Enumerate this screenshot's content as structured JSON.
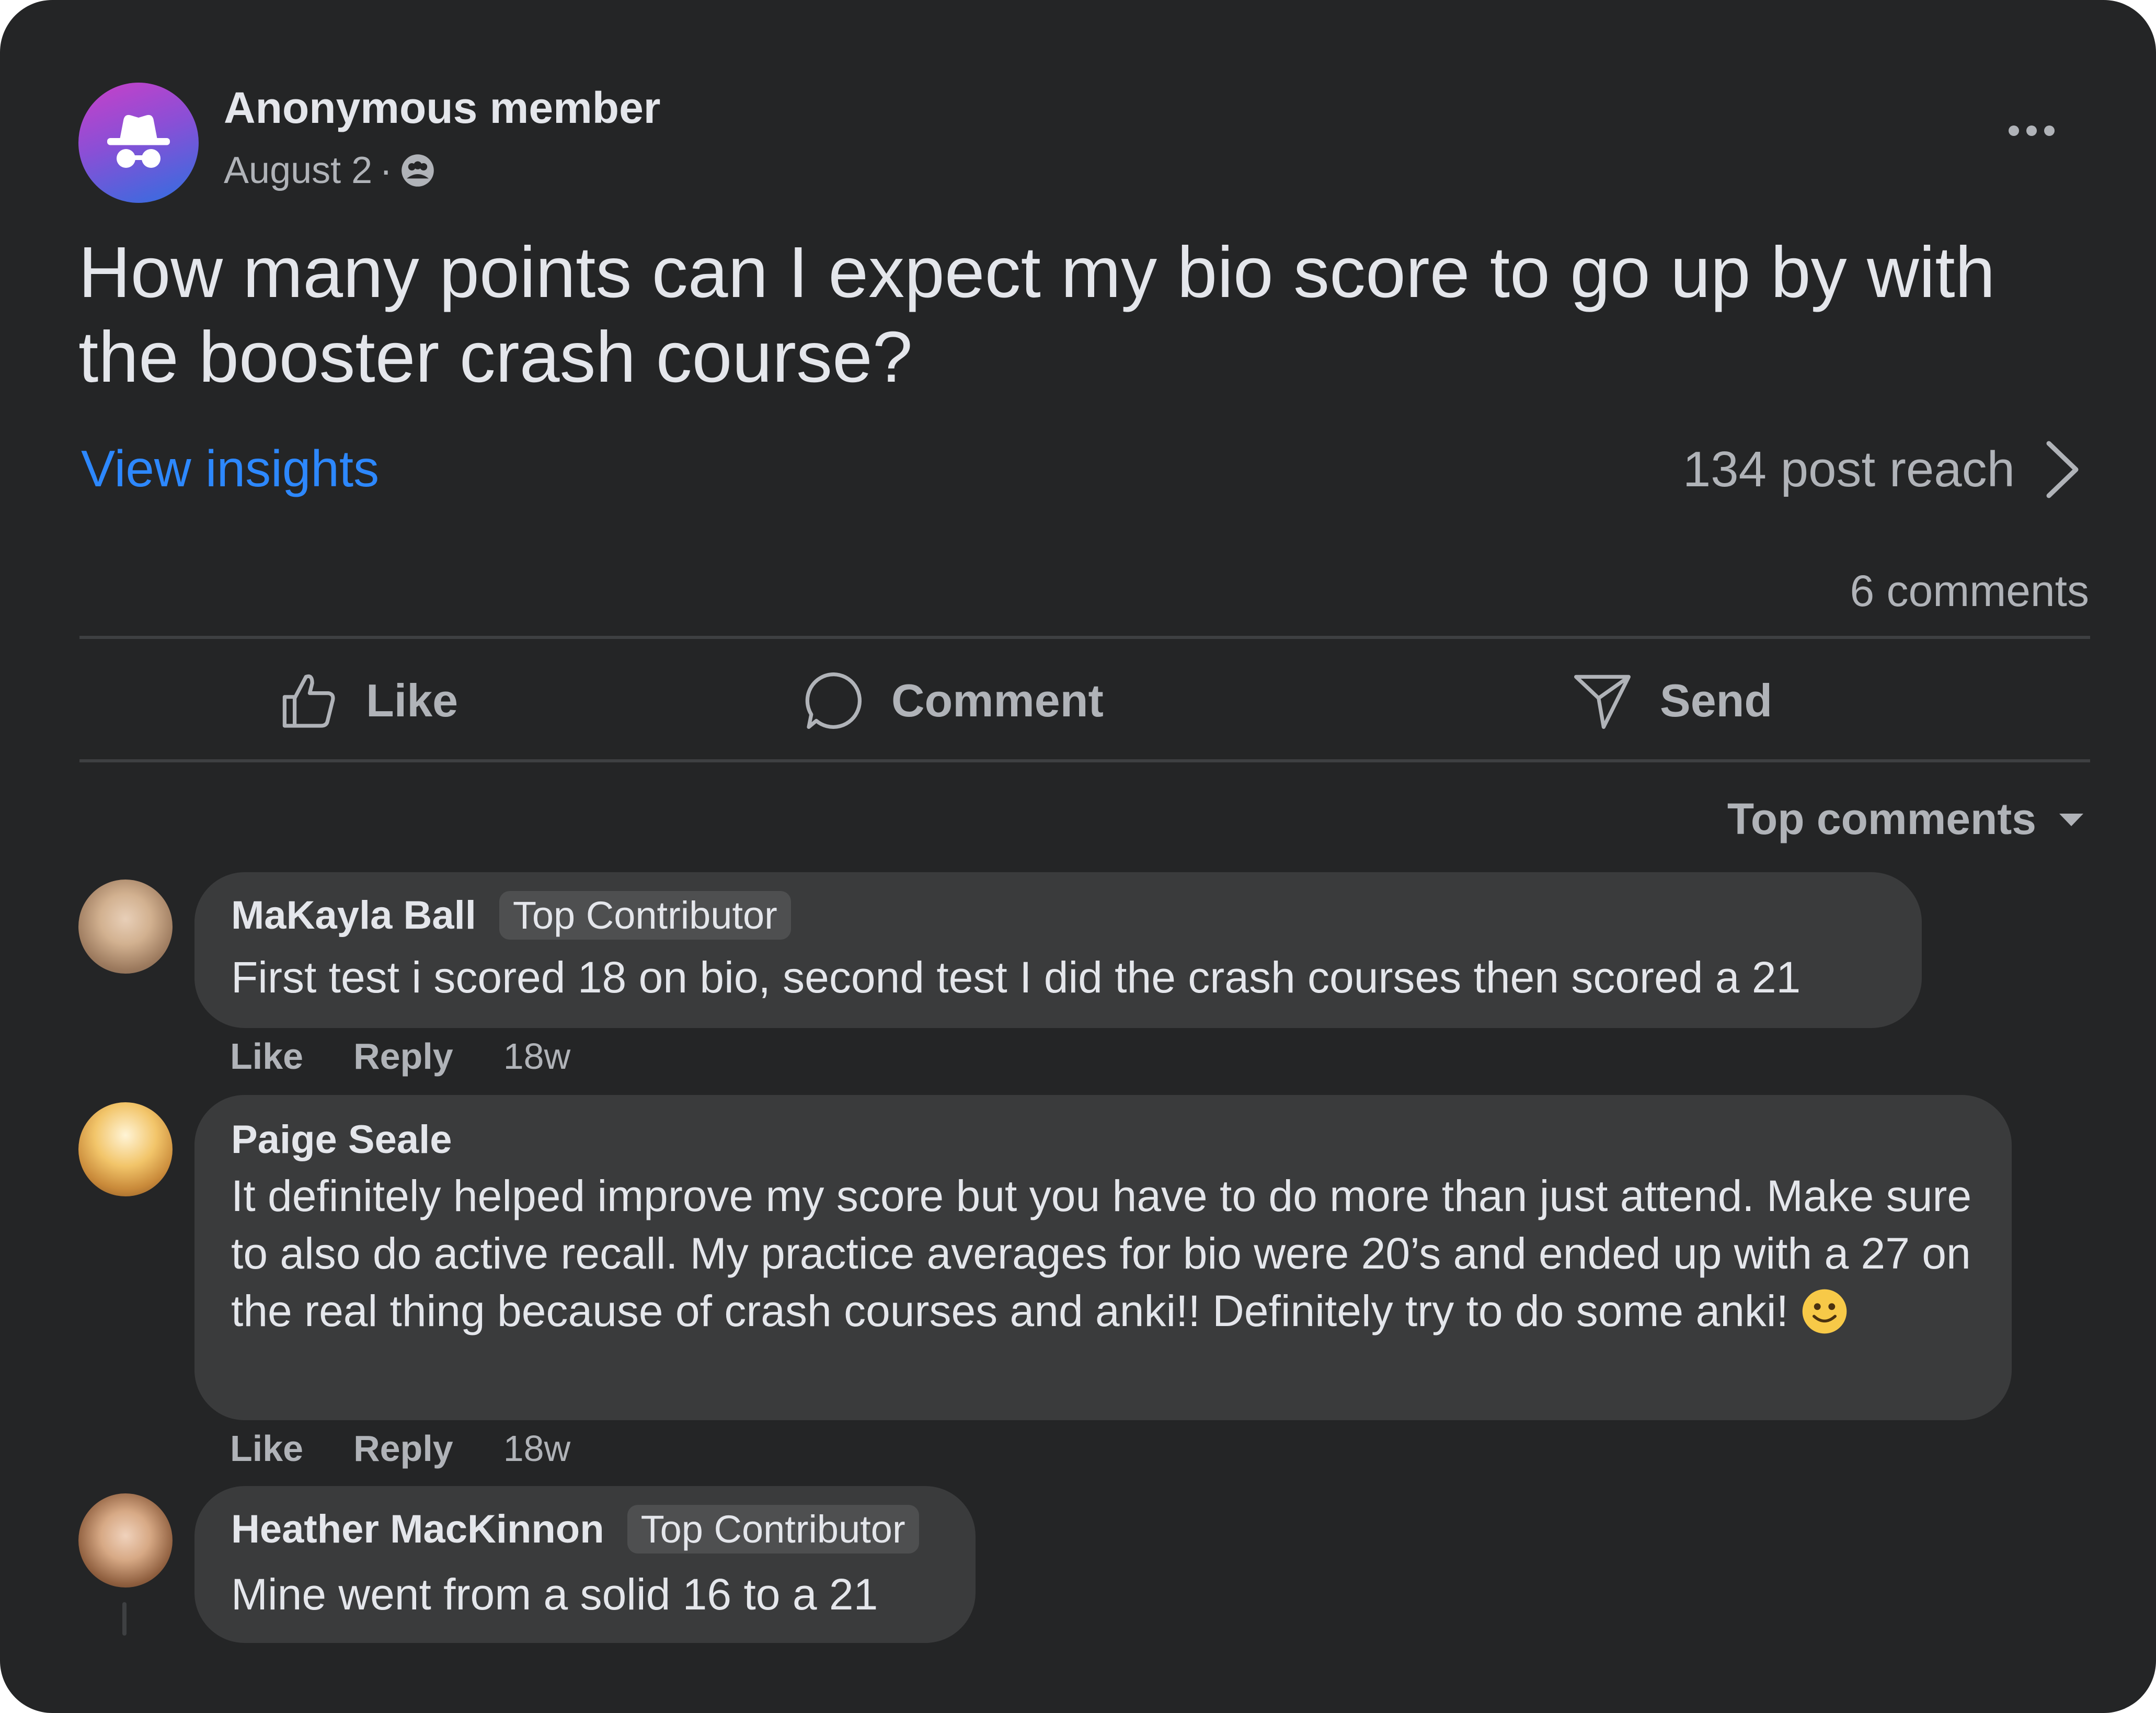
{
  "post": {
    "author": "Anonymous member",
    "date": "August 2",
    "separator": "·",
    "privacy_icon": "group-icon",
    "text": "How many points can I expect my bio score to go up by with the booster crash course?",
    "insights_label": "View insights",
    "reach_label": "134 post reach",
    "comment_count": "6 comments"
  },
  "actions": {
    "like": "Like",
    "comment": "Comment",
    "send": "Send"
  },
  "sort": {
    "label": "Top comments"
  },
  "comments": [
    {
      "name": "MaKayla Ball",
      "badge": "Top Contributor",
      "text": "First test i scored 18 on bio, second test I did the crash courses then scored a 21",
      "like": "Like",
      "reply": "Reply",
      "time": "18w"
    },
    {
      "name": "Paige Seale",
      "text": "It definitely helped improve my score but you have to do more than just attend. Make sure to also do active recall. My practice averages for bio were 20’s and ended up with a 27 on the real thing because of crash courses and anki!! Definitely try to do some anki!",
      "like": "Like",
      "reply": "Reply",
      "time": "18w"
    },
    {
      "name": "Heather MacKinnon",
      "badge": "Top Contributor",
      "text": "Mine went from a solid 16 to a 21"
    }
  ],
  "colors": {
    "background": "#242526",
    "bubble": "#3a3b3c",
    "link": "#2d88ff",
    "muted": "#b0b3b8",
    "text": "#e4e6eb"
  }
}
